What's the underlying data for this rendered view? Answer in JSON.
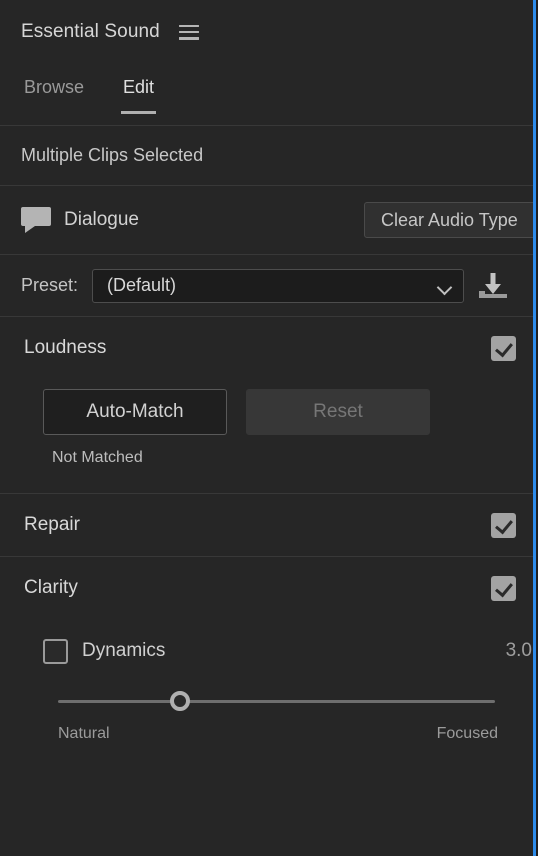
{
  "panel": {
    "title": "Essential Sound",
    "menu_icon": "hamburger-menu-icon"
  },
  "tabs": [
    {
      "label": "Browse",
      "active": false
    },
    {
      "label": "Edit",
      "active": true
    }
  ],
  "selection": {
    "text": "Multiple Clips Selected"
  },
  "audio_type": {
    "icon": "speech-bubble-icon",
    "label": "Dialogue",
    "clear_button_label": "Clear Audio Type"
  },
  "preset": {
    "label": "Preset:",
    "value": "(Default)",
    "chevron_icon": "chevron-down-icon",
    "save_icon": "save-preset-icon"
  },
  "sections": {
    "loudness": {
      "title": "Loudness",
      "checked": true,
      "auto_match_label": "Auto-Match",
      "reset_label": "Reset",
      "status": "Not Matched"
    },
    "repair": {
      "title": "Repair",
      "checked": true
    },
    "clarity": {
      "title": "Clarity",
      "checked": true,
      "dynamics": {
        "label": "Dynamics",
        "checked": false,
        "value": "3.0",
        "slider_percent": 28,
        "min_label": "Natural",
        "max_label": "Focused"
      }
    }
  },
  "colors": {
    "background": "#262626",
    "focus_border": "#2d8ceb",
    "divider": "#383838",
    "text_primary": "#d8d8d8",
    "text_secondary": "#9a9a9a",
    "checkbox_checked": "#a3a3a3"
  }
}
